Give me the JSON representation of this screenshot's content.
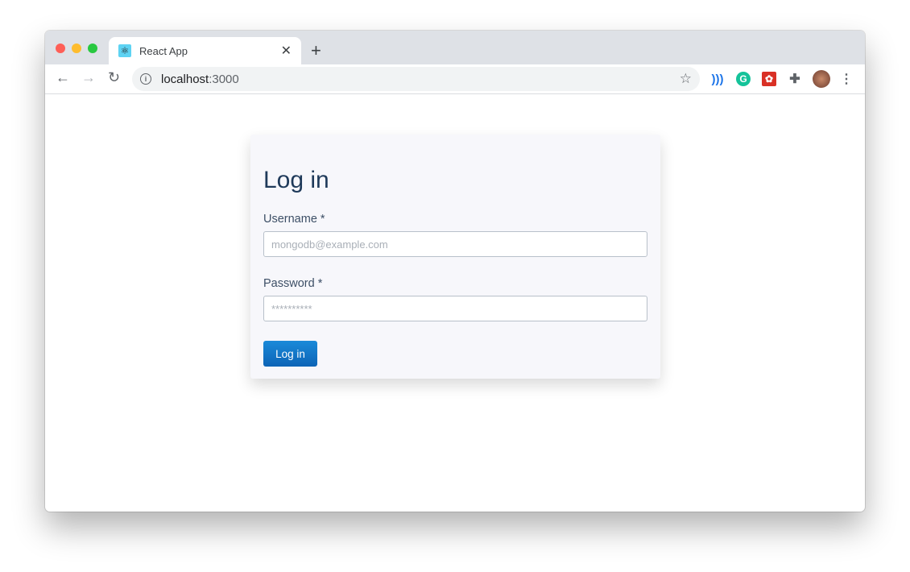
{
  "browser": {
    "tab_title": "React App",
    "url_host": "localhost",
    "url_port": ":3000",
    "favicon": "react-icon"
  },
  "colors": {
    "accent": "#0e6ec4",
    "title": "#1f3a5a"
  },
  "form": {
    "title": "Log in",
    "username_label": "Username *",
    "username_placeholder": "mongodb@example.com",
    "password_label": "Password *",
    "password_placeholder": "**********",
    "submit_label": "Log in"
  }
}
